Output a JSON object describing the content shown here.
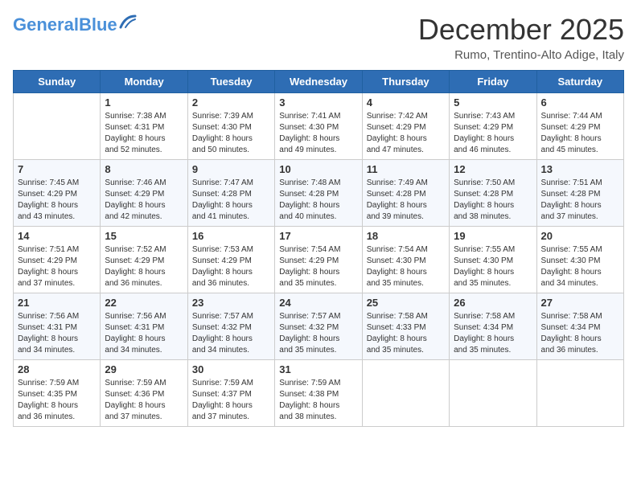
{
  "header": {
    "logo_general": "General",
    "logo_blue": "Blue",
    "month_title": "December 2025",
    "location": "Rumo, Trentino-Alto Adige, Italy"
  },
  "days_of_week": [
    "Sunday",
    "Monday",
    "Tuesday",
    "Wednesday",
    "Thursday",
    "Friday",
    "Saturday"
  ],
  "weeks": [
    [
      {
        "day": "",
        "info": ""
      },
      {
        "day": "1",
        "info": "Sunrise: 7:38 AM\nSunset: 4:31 PM\nDaylight: 8 hours\nand 52 minutes."
      },
      {
        "day": "2",
        "info": "Sunrise: 7:39 AM\nSunset: 4:30 PM\nDaylight: 8 hours\nand 50 minutes."
      },
      {
        "day": "3",
        "info": "Sunrise: 7:41 AM\nSunset: 4:30 PM\nDaylight: 8 hours\nand 49 minutes."
      },
      {
        "day": "4",
        "info": "Sunrise: 7:42 AM\nSunset: 4:29 PM\nDaylight: 8 hours\nand 47 minutes."
      },
      {
        "day": "5",
        "info": "Sunrise: 7:43 AM\nSunset: 4:29 PM\nDaylight: 8 hours\nand 46 minutes."
      },
      {
        "day": "6",
        "info": "Sunrise: 7:44 AM\nSunset: 4:29 PM\nDaylight: 8 hours\nand 45 minutes."
      }
    ],
    [
      {
        "day": "7",
        "info": "Sunrise: 7:45 AM\nSunset: 4:29 PM\nDaylight: 8 hours\nand 43 minutes."
      },
      {
        "day": "8",
        "info": "Sunrise: 7:46 AM\nSunset: 4:29 PM\nDaylight: 8 hours\nand 42 minutes."
      },
      {
        "day": "9",
        "info": "Sunrise: 7:47 AM\nSunset: 4:28 PM\nDaylight: 8 hours\nand 41 minutes."
      },
      {
        "day": "10",
        "info": "Sunrise: 7:48 AM\nSunset: 4:28 PM\nDaylight: 8 hours\nand 40 minutes."
      },
      {
        "day": "11",
        "info": "Sunrise: 7:49 AM\nSunset: 4:28 PM\nDaylight: 8 hours\nand 39 minutes."
      },
      {
        "day": "12",
        "info": "Sunrise: 7:50 AM\nSunset: 4:28 PM\nDaylight: 8 hours\nand 38 minutes."
      },
      {
        "day": "13",
        "info": "Sunrise: 7:51 AM\nSunset: 4:28 PM\nDaylight: 8 hours\nand 37 minutes."
      }
    ],
    [
      {
        "day": "14",
        "info": "Sunrise: 7:51 AM\nSunset: 4:29 PM\nDaylight: 8 hours\nand 37 minutes."
      },
      {
        "day": "15",
        "info": "Sunrise: 7:52 AM\nSunset: 4:29 PM\nDaylight: 8 hours\nand 36 minutes."
      },
      {
        "day": "16",
        "info": "Sunrise: 7:53 AM\nSunset: 4:29 PM\nDaylight: 8 hours\nand 36 minutes."
      },
      {
        "day": "17",
        "info": "Sunrise: 7:54 AM\nSunset: 4:29 PM\nDaylight: 8 hours\nand 35 minutes."
      },
      {
        "day": "18",
        "info": "Sunrise: 7:54 AM\nSunset: 4:30 PM\nDaylight: 8 hours\nand 35 minutes."
      },
      {
        "day": "19",
        "info": "Sunrise: 7:55 AM\nSunset: 4:30 PM\nDaylight: 8 hours\nand 35 minutes."
      },
      {
        "day": "20",
        "info": "Sunrise: 7:55 AM\nSunset: 4:30 PM\nDaylight: 8 hours\nand 34 minutes."
      }
    ],
    [
      {
        "day": "21",
        "info": "Sunrise: 7:56 AM\nSunset: 4:31 PM\nDaylight: 8 hours\nand 34 minutes."
      },
      {
        "day": "22",
        "info": "Sunrise: 7:56 AM\nSunset: 4:31 PM\nDaylight: 8 hours\nand 34 minutes."
      },
      {
        "day": "23",
        "info": "Sunrise: 7:57 AM\nSunset: 4:32 PM\nDaylight: 8 hours\nand 34 minutes."
      },
      {
        "day": "24",
        "info": "Sunrise: 7:57 AM\nSunset: 4:32 PM\nDaylight: 8 hours\nand 35 minutes."
      },
      {
        "day": "25",
        "info": "Sunrise: 7:58 AM\nSunset: 4:33 PM\nDaylight: 8 hours\nand 35 minutes."
      },
      {
        "day": "26",
        "info": "Sunrise: 7:58 AM\nSunset: 4:34 PM\nDaylight: 8 hours\nand 35 minutes."
      },
      {
        "day": "27",
        "info": "Sunrise: 7:58 AM\nSunset: 4:34 PM\nDaylight: 8 hours\nand 36 minutes."
      }
    ],
    [
      {
        "day": "28",
        "info": "Sunrise: 7:59 AM\nSunset: 4:35 PM\nDaylight: 8 hours\nand 36 minutes."
      },
      {
        "day": "29",
        "info": "Sunrise: 7:59 AM\nSunset: 4:36 PM\nDaylight: 8 hours\nand 37 minutes."
      },
      {
        "day": "30",
        "info": "Sunrise: 7:59 AM\nSunset: 4:37 PM\nDaylight: 8 hours\nand 37 minutes."
      },
      {
        "day": "31",
        "info": "Sunrise: 7:59 AM\nSunset: 4:38 PM\nDaylight: 8 hours\nand 38 minutes."
      },
      {
        "day": "",
        "info": ""
      },
      {
        "day": "",
        "info": ""
      },
      {
        "day": "",
        "info": ""
      }
    ]
  ]
}
